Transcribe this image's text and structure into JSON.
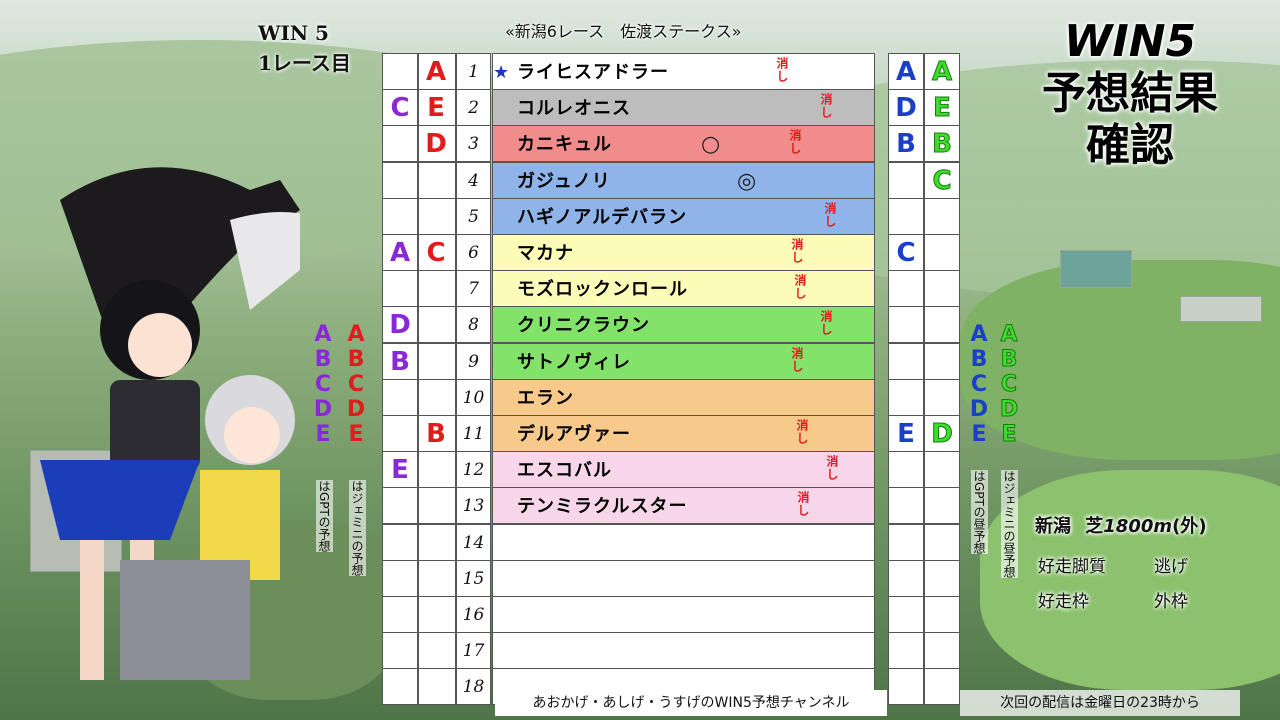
{
  "corner": {
    "line1": "WIN 5",
    "line2": "1レース目"
  },
  "race_header": "«新潟6レース　佐渡ステークス»",
  "big_title": {
    "line1": "WIN5",
    "line2": "予想結果",
    "line3": "確認"
  },
  "rows": [
    {
      "num": "1",
      "name": "ライヒスアドラー",
      "color": "#ffffff",
      "star": true,
      "mark": "",
      "kesi": "消し",
      "gpt": "",
      "gem": "A",
      "right1": "A",
      "right2": "A"
    },
    {
      "num": "2",
      "name": "コルレオニス",
      "color": "#bdbdbd",
      "star": false,
      "mark": "",
      "kesi": "消し",
      "gpt": "C",
      "gem": "E",
      "right1": "D",
      "right2": "E"
    },
    {
      "num": "3",
      "name": "カニキュル",
      "color": "#f08c8c",
      "star": false,
      "mark": "○",
      "kesi": "消し",
      "gpt": "",
      "gem": "D",
      "right1": "B",
      "right2": "B"
    },
    {
      "num": "4",
      "name": "ガジュノリ",
      "color": "#8fb4ea",
      "star": false,
      "mark": "◎",
      "kesi": "",
      "gpt": "",
      "gem": "",
      "right1": "",
      "right2": "C"
    },
    {
      "num": "5",
      "name": "ハギノアルデバラン",
      "color": "#8fb4ea",
      "star": false,
      "mark": "",
      "kesi": "消し",
      "gpt": "",
      "gem": "",
      "right1": "",
      "right2": ""
    },
    {
      "num": "6",
      "name": "マカナ",
      "color": "#fdfbb8",
      "star": false,
      "mark": "",
      "kesi": "消し",
      "gpt": "A",
      "gem": "C",
      "right1": "C",
      "right2": ""
    },
    {
      "num": "7",
      "name": "モズロックンロール",
      "color": "#fdfbb8",
      "star": false,
      "mark": "",
      "kesi": "消し",
      "gpt": "",
      "gem": "",
      "right1": "",
      "right2": ""
    },
    {
      "num": "8",
      "name": "クリニクラウン",
      "color": "#82e26a",
      "star": false,
      "mark": "",
      "kesi": "消し",
      "gpt": "D",
      "gem": "",
      "right1": "",
      "right2": ""
    },
    {
      "num": "9",
      "name": "サトノヴィレ",
      "color": "#82e26a",
      "star": false,
      "mark": "",
      "kesi": "消し",
      "gpt": "B",
      "gem": "",
      "right1": "",
      "right2": ""
    },
    {
      "num": "10",
      "name": "エラン",
      "color": "#f7c98a",
      "star": false,
      "mark": "",
      "kesi": "",
      "gpt": "",
      "gem": "",
      "right1": "",
      "right2": ""
    },
    {
      "num": "11",
      "name": "デルアヴァー",
      "color": "#f7c98a",
      "star": false,
      "mark": "",
      "kesi": "消し",
      "gpt": "",
      "gem": "B",
      "right1": "E",
      "right2": "D"
    },
    {
      "num": "12",
      "name": "エスコバル",
      "color": "#f8d6ea",
      "star": false,
      "mark": "",
      "kesi": "消し",
      "gpt": "E",
      "gem": "",
      "right1": "",
      "right2": ""
    },
    {
      "num": "13",
      "name": "テンミラクルスター",
      "color": "#f8d6ea",
      "star": false,
      "mark": "",
      "kesi": "消し",
      "gpt": "",
      "gem": "",
      "right1": "",
      "right2": ""
    },
    {
      "num": "14",
      "name": "",
      "color": "#ffffff",
      "star": false,
      "mark": "",
      "kesi": "",
      "gpt": "",
      "gem": "",
      "right1": "",
      "right2": ""
    },
    {
      "num": "15",
      "name": "",
      "color": "#ffffff",
      "star": false,
      "mark": "",
      "kesi": "",
      "gpt": "",
      "gem": "",
      "right1": "",
      "right2": ""
    },
    {
      "num": "16",
      "name": "",
      "color": "#ffffff",
      "star": false,
      "mark": "",
      "kesi": "",
      "gpt": "",
      "gem": "",
      "right1": "",
      "right2": ""
    },
    {
      "num": "17",
      "name": "",
      "color": "#ffffff",
      "star": false,
      "mark": "",
      "kesi": "",
      "gpt": "",
      "gem": "",
      "right1": "",
      "right2": ""
    },
    {
      "num": "18",
      "name": "",
      "color": "#ffffff",
      "star": false,
      "mark": "",
      "kesi": "",
      "gpt": "",
      "gem": "",
      "right1": "",
      "right2": ""
    }
  ],
  "left_legend": {
    "gpt_letters": [
      "A",
      "B",
      "C",
      "D",
      "E"
    ],
    "gpt_note": "はGPTの予想",
    "gem_letters": [
      "A",
      "B",
      "C",
      "D",
      "E"
    ],
    "gem_note": "はジェミニの予想"
  },
  "right_legend": {
    "gpt_letters": [
      "A",
      "B",
      "C",
      "D",
      "E"
    ],
    "gpt_note": "はGPTの昼予想",
    "gem_letters": [
      "A",
      "B",
      "C",
      "D",
      "E"
    ],
    "gem_note": "はジェミニの昼予想"
  },
  "course": {
    "place": "新潟",
    "surface": "芝",
    "distance": "1800m",
    "note": "(外)"
  },
  "info": [
    {
      "label": "好走脚質",
      "value": "逃げ"
    },
    {
      "label": "好走枠",
      "value": "外枠"
    }
  ],
  "channel": "あおかげ・あしげ・うすげのWIN5予想チャンネル",
  "next_stream": "次回の配信は金曜日の23時から",
  "colors": {
    "red": "#e01c1c",
    "purple": "#8a28d8",
    "blue": "#1a3fc8",
    "green": "#22c21c"
  }
}
